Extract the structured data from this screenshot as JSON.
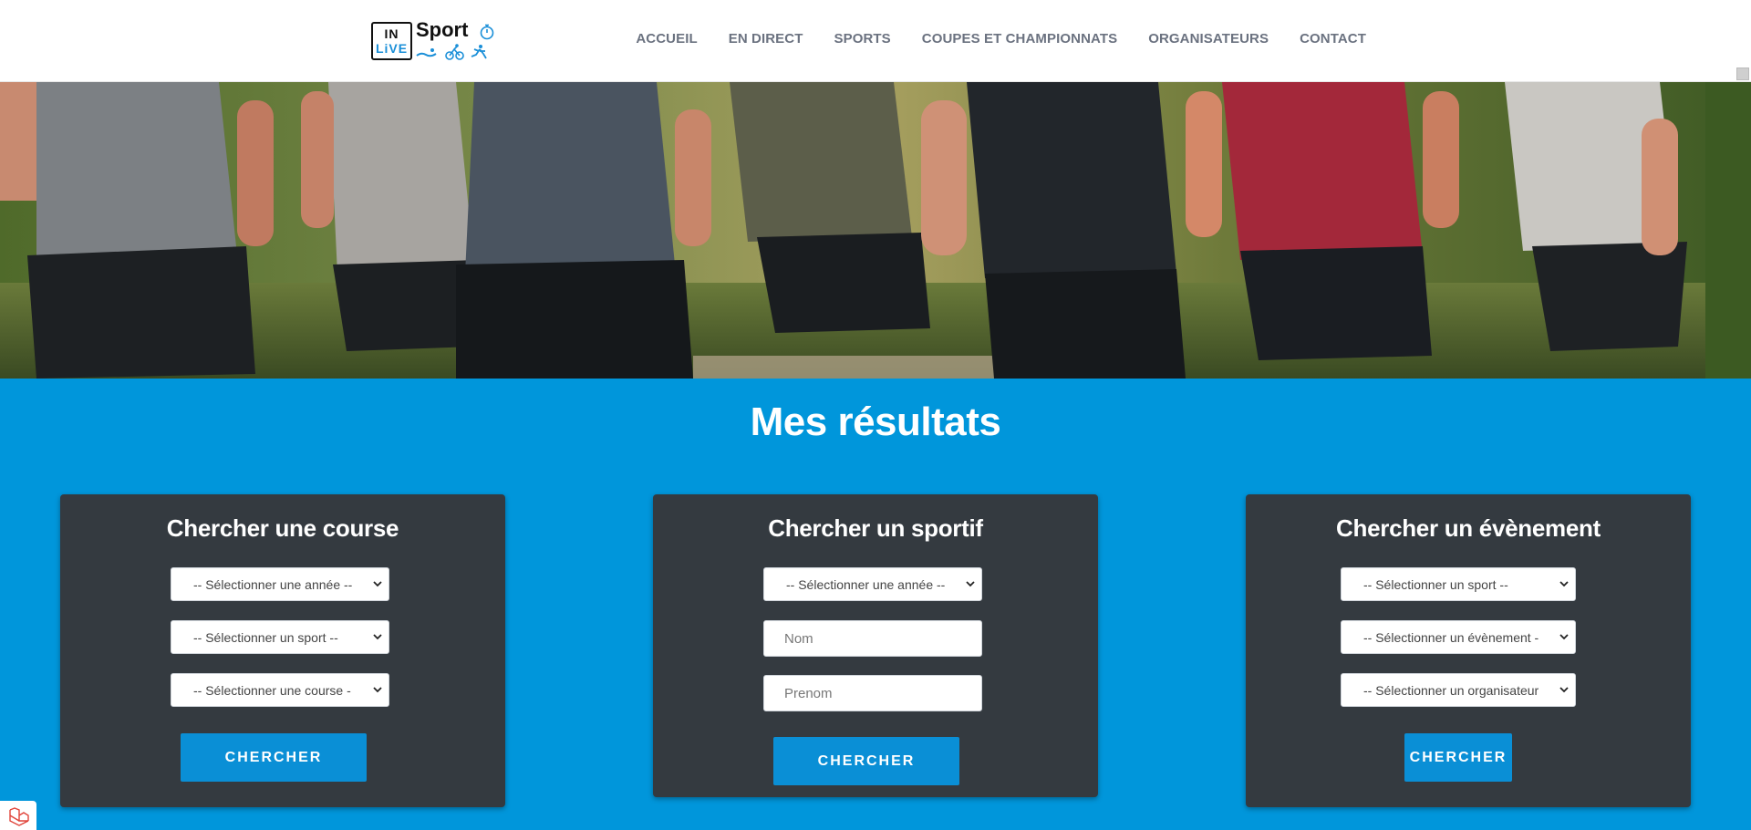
{
  "header": {
    "logo": {
      "box_line1": "IN",
      "box_line2": "LiVE",
      "sport": "Sport"
    },
    "nav": [
      "ACCUEIL",
      "EN DIRECT",
      "SPORTS",
      "COUPES ET CHAMPIONNATS",
      "ORGANISATEURS",
      "CONTACT"
    ]
  },
  "main": {
    "title": "Mes résultats",
    "cards": [
      {
        "title": "Chercher une course",
        "fields": [
          "-- Sélectionner une année --",
          "-- Sélectionner un sport --",
          "-- Sélectionner une course -"
        ],
        "button": "CHERCHER"
      },
      {
        "title": "Chercher un sportif",
        "select": "-- Sélectionner une année --",
        "inputs": [
          {
            "placeholder": "Nom"
          },
          {
            "placeholder": "Prenom"
          }
        ],
        "button": "CHERCHER"
      },
      {
        "title": "Chercher un évènement",
        "fields": [
          "-- Sélectionner un sport --",
          "-- Sélectionner un évènement -",
          "-- Sélectionner un organisateur"
        ],
        "button": "CHERCHER"
      }
    ]
  },
  "colors": {
    "accent": "#0096db",
    "card_bg": "#343a40",
    "button": "#0a8fd6",
    "logo_blue": "#1a8fd8"
  }
}
